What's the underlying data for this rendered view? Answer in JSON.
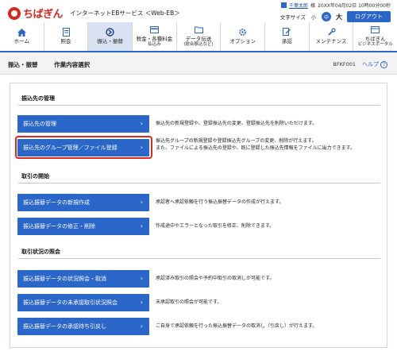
{
  "header": {
    "logo": "ちばぎん",
    "service": "インターネットEBサービス ＜Web-EB＞",
    "user_name": "千葉太郎",
    "user_suffix": "様",
    "last_login": "20XX年04月02日 10時00分00秒",
    "font_size_label": "文字サイズ",
    "font_small": "小",
    "font_medium": "中",
    "font_large": "大",
    "logout": "ログアウト"
  },
  "nav": [
    {
      "label": "ホーム",
      "icon": "home-icon"
    },
    {
      "label": "照会",
      "icon": "document-icon"
    },
    {
      "label": "振込・振替",
      "icon": "transfer-icon",
      "active": true
    },
    {
      "label": "税金・各種料金",
      "sub": "払込み",
      "icon": "invoice-icon"
    },
    {
      "label": "データ伝送",
      "sub": "(総合振込など)",
      "icon": "folder-icon"
    },
    {
      "label": "オプション",
      "icon": "gear-icon"
    },
    {
      "label": "承認",
      "icon": "approval-icon"
    },
    {
      "label": "メンテナンス",
      "icon": "wrench-icon"
    },
    {
      "label": "ちばぎん",
      "sub": "ビジネスポータル",
      "icon": "portal-icon"
    }
  ],
  "titlebar": {
    "crumb1": "振込・振替",
    "crumb2": "作業内容選択",
    "screen_id": "BFKF001",
    "help": "ヘルプ"
  },
  "sections": {
    "s1_title": "振込先の管理",
    "s2_title": "取引の開始",
    "s3_title": "取引状況の照会"
  },
  "buttons": {
    "b1": "振込先の管理",
    "b2": "振込先のグループ管理／ファイル登録",
    "b3": "振込振替データの新規作成",
    "b4": "振込振替データの修正・削除",
    "b5": "振込振替データの状況照会・取消",
    "b6": "振込振替データの未承認取引状況照会",
    "b7": "振込振替データの承認待ち引戻し"
  },
  "descriptions": {
    "d1": "振込先の新規登録や、登録振込先の変更、登録振込先を削除いただけます。",
    "d2a": "振込先グループの新規登録や登録振込先グループの変更、削除が行えます。",
    "d2b": "また、ファイルによる振込先の登録や、既に登録した振込先情報をファイルに出力できます。",
    "d3": "承認者へ承認依頼を行う振込振替データの作成が行えます。",
    "d4": "作成途中やエラーとなった取引を修正、削除できます。",
    "d5": "承認済み取引の照会や予約中取引の取消しが可能です。",
    "d6": "未承認取引の照会が可能です。",
    "d7": "ご自身で承認依頼を行った振込振替データの取消し（引戻し）が行えます。"
  },
  "colors": {
    "primary": "#2b66c9",
    "brand": "#d9261c",
    "highlight": "#e1261c"
  }
}
